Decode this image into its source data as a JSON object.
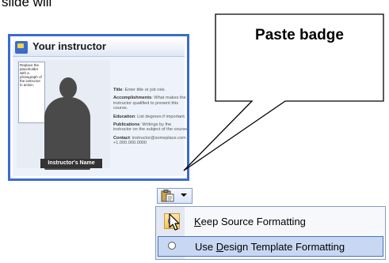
{
  "caption": {
    "text": "slide will"
  },
  "slide": {
    "title": "Your instructor",
    "placeholder_note": "Replace the placeholder with a photograph of the instructor in action.",
    "name_tag": "Instructor's Name",
    "fields": [
      {
        "label": "Title",
        "text": ": Enter title or job role."
      },
      {
        "label": "Accomplishments",
        "text": ": What makes the instructor qualified to present this course."
      },
      {
        "label": "Education",
        "text": ": List degrees if important."
      },
      {
        "label": "Publications",
        "text": ": Writings by the instructor on the subject of the course."
      },
      {
        "label": "Contact",
        "text": ": instructor@someplace.com +1.000.000.0000"
      }
    ]
  },
  "callout": {
    "label": "Paste badge"
  },
  "paste_button": {
    "icon": "clipboard-icon"
  },
  "menu": {
    "items": [
      {
        "label_prefix": "",
        "label_accel": "K",
        "label_rest": "eep Source Formatting",
        "icon": "keep-source-icon"
      },
      {
        "label_prefix": "Use ",
        "label_accel": "D",
        "label_rest": "esign Template Formatting",
        "icon": "radio-icon"
      }
    ]
  },
  "colors": {
    "accent": "#3b6ccc",
    "highlight": "#c8d8f2"
  }
}
